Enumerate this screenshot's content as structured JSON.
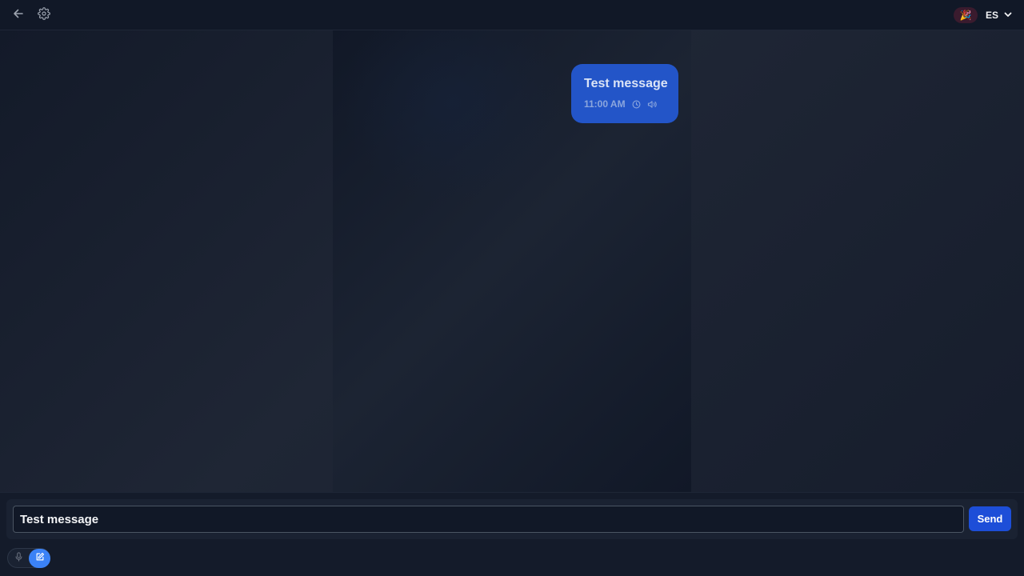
{
  "header": {
    "back_icon": "arrow-left-icon",
    "settings_icon": "gear-icon",
    "badge_emoji": "🎉",
    "language": "ES"
  },
  "conversation": {
    "messages": [
      {
        "text": "Test message",
        "time": "11:00 AM"
      }
    ]
  },
  "composer": {
    "input_value": "Test message",
    "send_label": "Send"
  },
  "mode_toggle": {
    "voice_icon": "microphone-icon",
    "text_icon": "edit-icon",
    "active": "text"
  },
  "colors": {
    "bubble": "#2355c8",
    "send_button": "#1d4ed8",
    "active_mode": "#3b82f6",
    "background": "#141b2a"
  }
}
